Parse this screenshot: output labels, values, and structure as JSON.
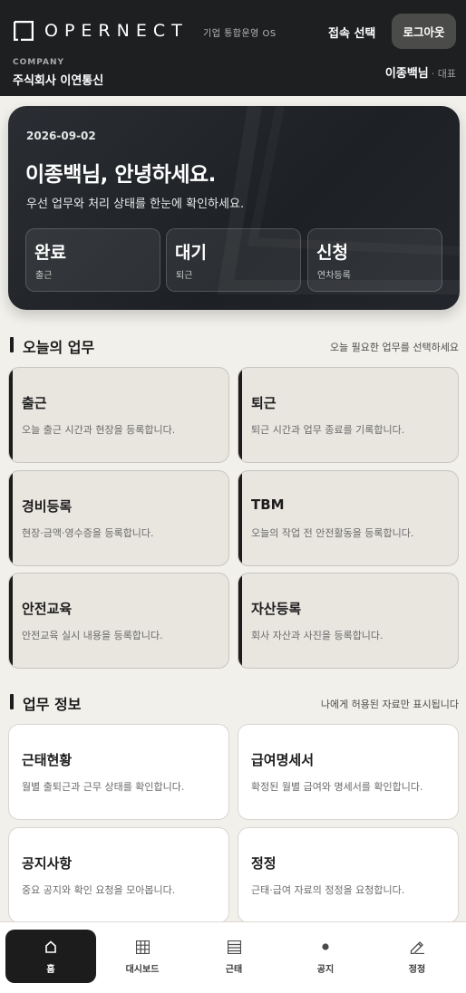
{
  "header": {
    "logo_text": "OPERNECT",
    "logo_sub": "기업 통합운영 OS",
    "select_label": "접속 선택",
    "logout_label": "로그아웃",
    "company_label": "COMPANY",
    "company_name": "주식회사 이연통신",
    "user_name": "이종백님",
    "user_role": "· 대표"
  },
  "hero": {
    "date": "2026-09-02",
    "title": "이종백님, 안녕하세요.",
    "description": "우선 업무와 처리 상태를 한눈에 확인하세요.",
    "stats": [
      {
        "value": "완료",
        "label": "출근"
      },
      {
        "value": "대기",
        "label": "퇴근"
      },
      {
        "value": "신청",
        "label": "연차등록"
      }
    ]
  },
  "today": {
    "title": "오늘의 업무",
    "hint": "오늘 필요한 업무를 선택하세요",
    "cards": [
      {
        "title": "출근",
        "desc": "오늘 출근 시간과 현장을 등록합니다."
      },
      {
        "title": "퇴근",
        "desc": "퇴근 시간과 업무 종료를 기록합니다."
      },
      {
        "title": "경비등록",
        "desc": "현장·금액·영수증을 등록합니다."
      },
      {
        "title": "TBM",
        "desc": "오늘의 작업 전 안전활동을 등록합니다."
      },
      {
        "title": "안전교육",
        "desc": "안전교육 실시 내용을 등록합니다."
      },
      {
        "title": "자산등록",
        "desc": "회사 자산과 사진을 등록합니다."
      }
    ]
  },
  "info": {
    "title": "업무 정보",
    "hint": "나에게 허용된 자료만 표시됩니다",
    "cards": [
      {
        "title": "근태현황",
        "desc": "월별 출퇴근과 근무 상태를 확인합니다."
      },
      {
        "title": "급여명세서",
        "desc": "확정된 월별 급여와 명세서를 확인합니다."
      },
      {
        "title": "공지사항",
        "desc": "중요 공지와 확인 요청을 모아봅니다."
      },
      {
        "title": "정정",
        "desc": "근태·급여 자료의 정정을 요청합니다."
      }
    ]
  },
  "nav": {
    "items": [
      {
        "label": "홈",
        "icon": "home-icon"
      },
      {
        "label": "대시보드",
        "icon": "grid-icon"
      },
      {
        "label": "근태",
        "icon": "list-icon"
      },
      {
        "label": "공지",
        "icon": "dot-icon"
      },
      {
        "label": "정정",
        "icon": "pencil-icon"
      }
    ]
  },
  "colors": {
    "header_bg": "#1e1f21",
    "page_bg": "#f2f0eb",
    "task_card_bg": "#e9e6e0",
    "accent_dark": "#1c1c1c"
  }
}
